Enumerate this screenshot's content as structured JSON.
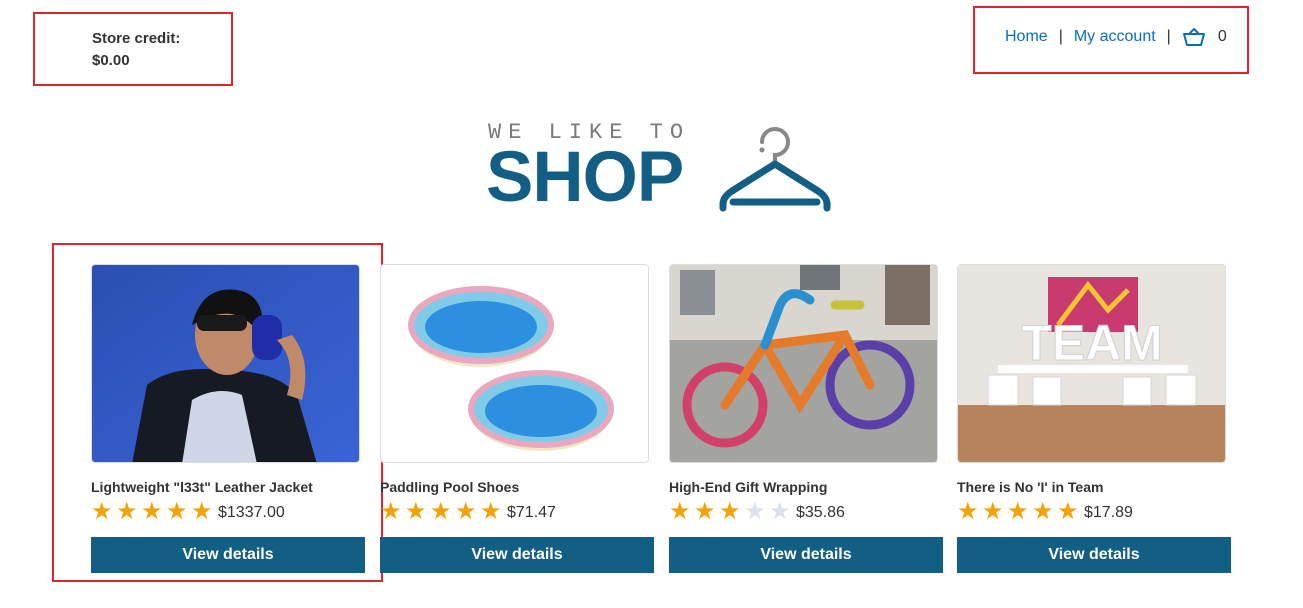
{
  "header": {
    "store_credit_label": "Store credit:",
    "store_credit_value": "$0.00",
    "nav": {
      "home": "Home",
      "separator": "|",
      "my_account": "My account",
      "cart_count": "0",
      "cart_icon": "basket-icon"
    }
  },
  "logo": {
    "tagline": "WE LIKE TO",
    "title": "SHOP",
    "icon": "hanger-icon"
  },
  "products": [
    {
      "name": "Lightweight \"l33t\" Leather Jacket",
      "rating": 5,
      "price": "$1337.00",
      "button": "View details"
    },
    {
      "name": "Paddling Pool Shoes",
      "rating": 5,
      "price": "$71.47",
      "button": "View details"
    },
    {
      "name": "High-End Gift Wrapping",
      "rating": 3,
      "price": "$35.86",
      "button": "View details"
    },
    {
      "name": "There is No 'I' in Team",
      "rating": 5,
      "price": "$17.89",
      "button": "View details"
    }
  ],
  "colors": {
    "brand": "#135e85",
    "link": "#0a6ebd",
    "star": "#f5a20a",
    "highlight_box": "#e0242f"
  }
}
